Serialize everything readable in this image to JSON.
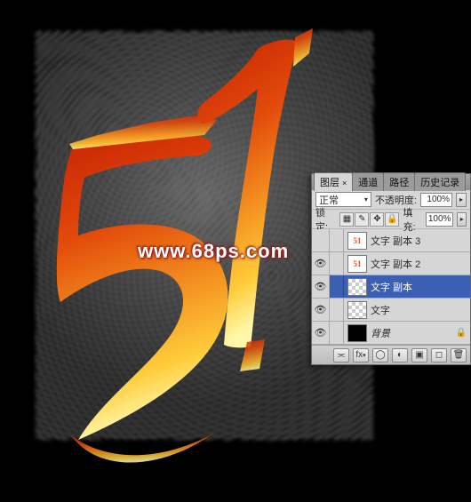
{
  "watermark": "www.68ps.com",
  "panel": {
    "tabs": {
      "layers": "图层",
      "channels": "通道",
      "paths": "路径",
      "history": "历史记录"
    },
    "blendMode": "正常",
    "opacityLabel": "不透明度:",
    "opacityValue": "100%",
    "lockLabel": "锁定:",
    "fillLabel": "填充:",
    "fillValue": "100%",
    "layers": [
      {
        "name": "文字 副本 3",
        "visible": false,
        "selected": false,
        "thumb": "mini51"
      },
      {
        "name": "文字 副本 2",
        "visible": true,
        "selected": false,
        "thumb": "mini51"
      },
      {
        "name": "文字 副本",
        "visible": true,
        "selected": true,
        "thumb": "transp"
      },
      {
        "name": "文字",
        "visible": true,
        "selected": false,
        "thumb": "transp"
      },
      {
        "name": "背景",
        "visible": true,
        "selected": false,
        "thumb": "bg",
        "italic": true,
        "locked": true
      }
    ],
    "icons": {
      "eye": "eye-icon",
      "link": "link-icon",
      "fx": "fx",
      "mask": "mask-icon",
      "adjustment": "adjustment-icon",
      "group": "group-icon",
      "new": "new-icon",
      "trash": "trash-icon"
    }
  }
}
